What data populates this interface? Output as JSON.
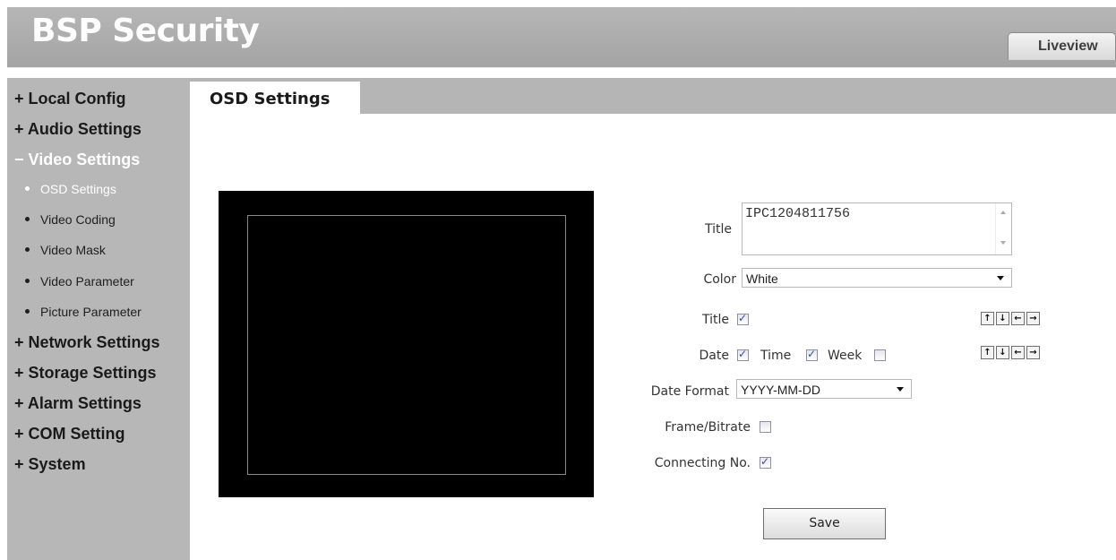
{
  "header": {
    "brand": "BSP Security",
    "liveview_tab": "Liveview"
  },
  "sidebar": {
    "sections": [
      {
        "sign": "+",
        "label": "Local Config"
      },
      {
        "sign": "+",
        "label": "Audio Settings"
      },
      {
        "sign": "−",
        "label": "Video Settings"
      },
      {
        "sign": "+",
        "label": "Network Settings"
      },
      {
        "sign": "+",
        "label": "Storage Settings"
      },
      {
        "sign": "+",
        "label": "Alarm Settings"
      },
      {
        "sign": "+",
        "label": "COM Setting"
      },
      {
        "sign": "+",
        "label": "System"
      }
    ],
    "video_sub_items": [
      "OSD Settings",
      "Video Coding",
      "Video Mask",
      "Video Parameter",
      "Picture Parameter"
    ],
    "active_sub_item": "OSD Settings"
  },
  "tab": {
    "label": "OSD Settings"
  },
  "form": {
    "title_label": "Title",
    "title_value": "IPC1204811756",
    "color_label": "Color",
    "color_value": "White",
    "title_show_label": "Title",
    "title_show_checked": true,
    "date_label": "Date",
    "date_checked": true,
    "time_label": "Time",
    "time_checked": true,
    "week_label": "Week",
    "week_checked": false,
    "date_format_label": "Date Format",
    "date_format_value": "YYYY-MM-DD",
    "frame_bitrate_label": "Frame/Bitrate",
    "frame_bitrate_checked": false,
    "connecting_label": "Connecting No.",
    "connecting_checked": true,
    "arrows": [
      "↑",
      "↓",
      "←",
      "→"
    ],
    "save_label": "Save"
  }
}
